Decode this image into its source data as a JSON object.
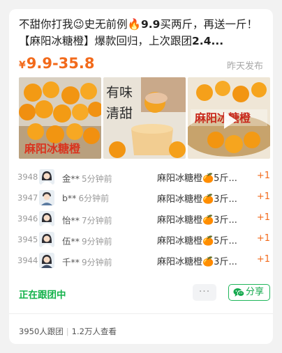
{
  "post": {
    "title_part1": "不甜你打我😉史无前例🔥",
    "title_bold1": "9.9",
    "title_part2": "买两斤，再送一斤！【麻阳冰糖橙】爆款回归，上次跟团",
    "title_bold2": "2.4...",
    "price_symbol": "¥",
    "price_range": "9.9-35.8",
    "posted": "昨天发布",
    "images": [
      {
        "caption": "麻阳冰糖橙",
        "icon": "oranges-photo"
      },
      {
        "caption": "有味清甜",
        "icon": "squeezing-orange-photo"
      },
      {
        "caption": "麻阳冰糖橙",
        "icon": "video-thumbnail",
        "has_play": true
      }
    ]
  },
  "orders": [
    {
      "num": "3948",
      "name": "金**",
      "time": "5分钟前",
      "item": "麻阳冰糖橙🍊5斤...",
      "qty": "+1",
      "avatar": "female-avatar"
    },
    {
      "num": "3947",
      "name": "b**",
      "time": "6分钟前",
      "item": "麻阳冰糖橙🍊3斤...",
      "qty": "+1",
      "avatar": "male-avatar"
    },
    {
      "num": "3946",
      "name": "怡**",
      "time": "7分钟前",
      "item": "麻阳冰糖橙🍊3斤...",
      "qty": "+1",
      "avatar": "female-avatar"
    },
    {
      "num": "3945",
      "name": "伍**",
      "time": "9分钟前",
      "item": "麻阳冰糖橙🍊5斤...",
      "qty": "+1",
      "avatar": "female-avatar"
    },
    {
      "num": "3944",
      "name": "千**",
      "time": "9分钟前",
      "item": "麻阳冰糖橙🍊3斤...",
      "qty": "+1",
      "avatar": "female-avatar"
    }
  ],
  "actions": {
    "status": "正在跟团中",
    "more": "···",
    "share": "分享"
  },
  "footer": {
    "joined": "3950人跟团",
    "views": "1.2万人查看"
  },
  "colors": {
    "accent": "#f26a1b",
    "status_green": "#13b24a"
  }
}
